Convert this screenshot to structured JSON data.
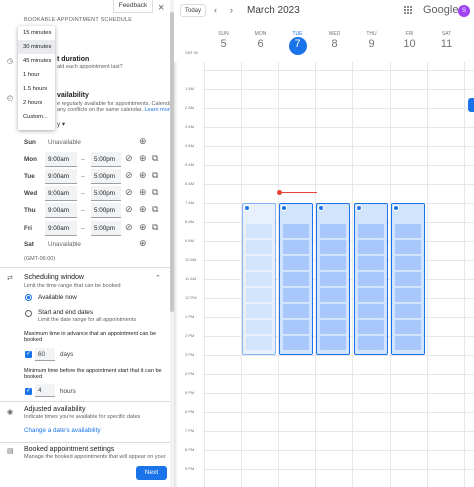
{
  "panel": {
    "header": "BOOKABLE APPOINTMENT SCHEDULE",
    "feedback": "Feedback",
    "duration": {
      "title": "Appointment duration",
      "title_visible": "t duration",
      "desc_visible": "ald each appointment last?",
      "options": [
        "15 minutes",
        "30 minutes",
        "45 minutes",
        "1 hour",
        "1.5 hours",
        "2 hours",
        "Custom..."
      ],
      "selected": "30 minutes"
    },
    "availability": {
      "title_visible": "vailability",
      "desc1": "e regularly available for appointments. Calendar",
      "desc2": "any conflicts on the same calendar.",
      "learn_more": "Learn more",
      "repeat_visible": "y",
      "days": [
        {
          "label": "Sun",
          "unavailable": "Unavailable"
        },
        {
          "label": "Mon",
          "start": "9:00am",
          "end": "5:00pm"
        },
        {
          "label": "Tue",
          "start": "9:00am",
          "end": "5:00pm"
        },
        {
          "label": "Wed",
          "start": "9:00am",
          "end": "5:00pm"
        },
        {
          "label": "Thu",
          "start": "9:00am",
          "end": "5:00pm"
        },
        {
          "label": "Fri",
          "start": "9:00am",
          "end": "5:00pm"
        },
        {
          "label": "Sat",
          "unavailable": "Unavailable"
        }
      ],
      "dash": "–",
      "timezone": "(GMT-06:00)"
    },
    "window": {
      "title": "Scheduling window",
      "desc": "Limit the time range that can be booked",
      "opt_available": "Available now",
      "opt_dates": "Start and end dates",
      "opt_dates_desc": "Limit the date range for all appointments",
      "max_label1": "Maximum time in advance that an appointment can be",
      "max_label2": "booked",
      "max_value": "60",
      "max_unit": "days",
      "min_label1": "Minimum time before the appointment start that it can be",
      "min_label2": "booked",
      "min_value": "4",
      "min_unit": "hours"
    },
    "adjusted": {
      "title": "Adjusted availability",
      "desc": "Indicate times you're available for specific dates",
      "link": "Change a date's availability"
    },
    "booked": {
      "title": "Booked appointment settings",
      "desc": "Manage the booked appointments that will appear on your"
    },
    "next": "Next"
  },
  "calendar": {
    "today": "Today",
    "month": "March 2023",
    "brand": "Google",
    "avatar": "S",
    "timezone": "GMT-06",
    "days": [
      {
        "dow": "SUN",
        "dom": "5"
      },
      {
        "dow": "MON",
        "dom": "6"
      },
      {
        "dow": "TUE",
        "dom": "7"
      },
      {
        "dow": "WED",
        "dom": "8"
      },
      {
        "dow": "THU",
        "dom": "9"
      },
      {
        "dow": "FRI",
        "dom": "10"
      },
      {
        "dow": "SAT",
        "dom": "11"
      }
    ],
    "hours": [
      "1 AM",
      "2 AM",
      "3 AM",
      "4 AM",
      "5 AM",
      "6 AM",
      "7 AM",
      "8 AM",
      "9 AM",
      "10 AM",
      "11 AM",
      "12 PM",
      "1 PM",
      "2 PM",
      "3 PM",
      "4 PM",
      "5 PM",
      "6 PM",
      "7 PM",
      "8 PM",
      "9 PM"
    ],
    "colors": {
      "accent": "#1a73e8",
      "now": "#ea4335"
    }
  }
}
